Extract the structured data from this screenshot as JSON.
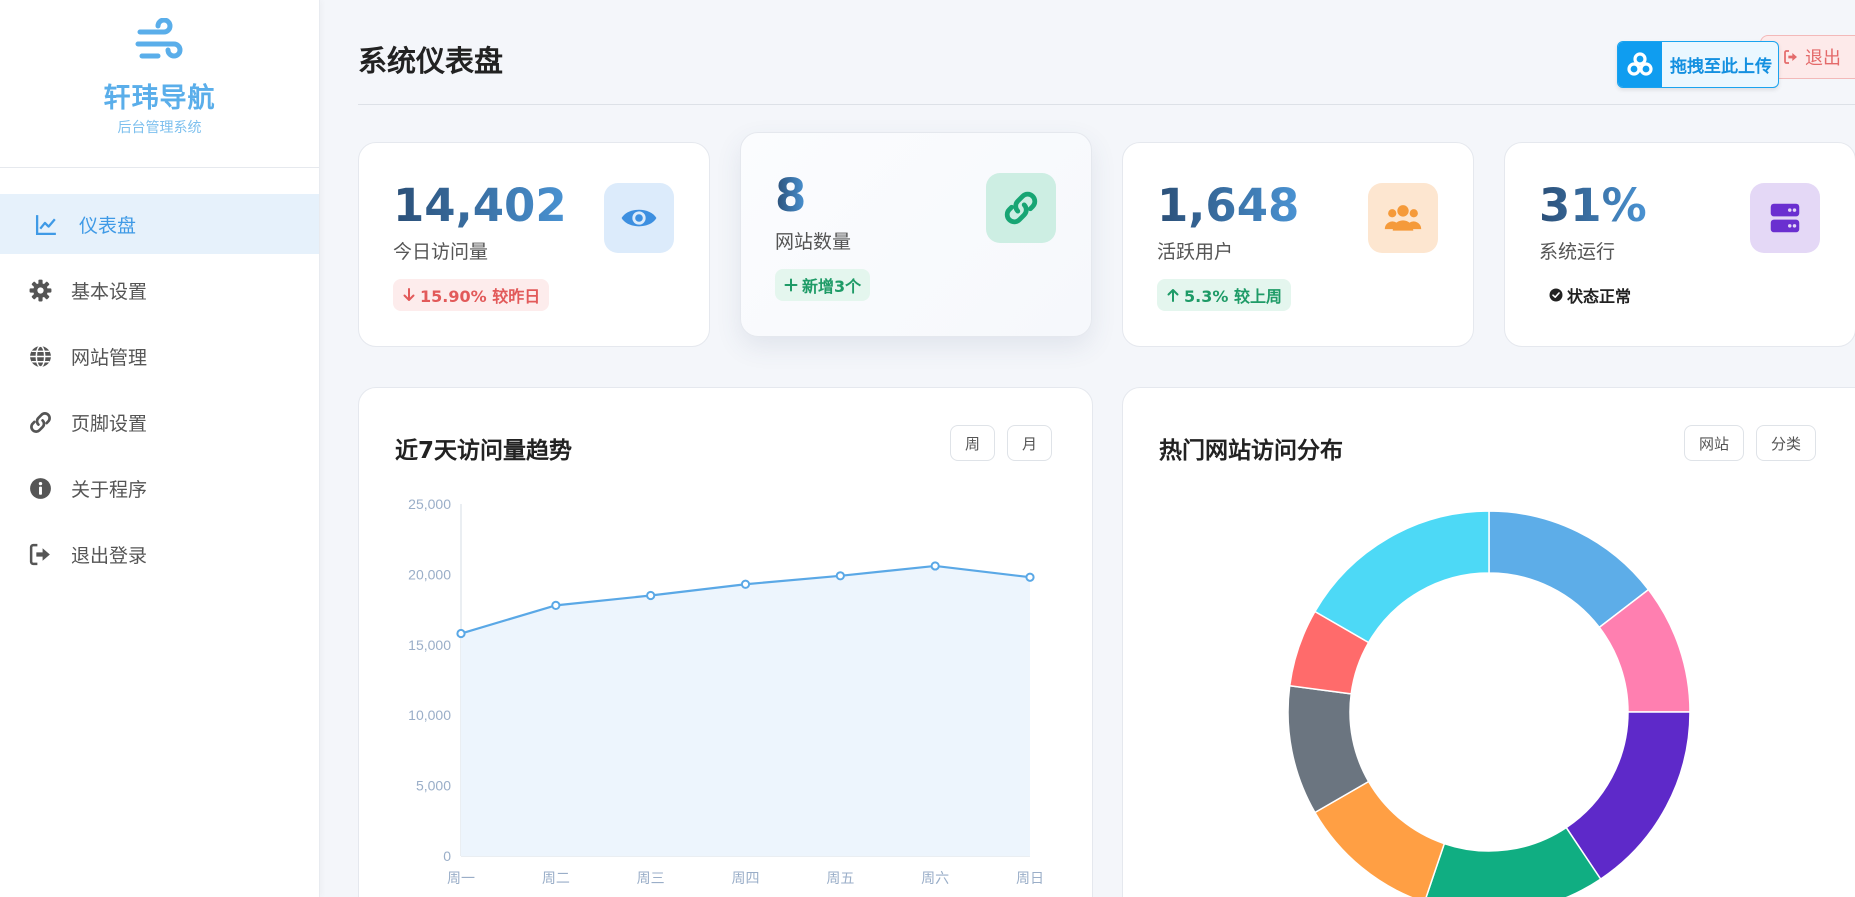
{
  "brand": {
    "name": "轩玮导航",
    "subtitle": "后台管理系统"
  },
  "sidebar": {
    "items": [
      {
        "label": "仪表盘",
        "icon": "chart-line-icon",
        "active": true
      },
      {
        "label": "基本设置",
        "icon": "gear-icon"
      },
      {
        "label": "网站管理",
        "icon": "globe-icon"
      },
      {
        "label": "页脚设置",
        "icon": "link-icon"
      },
      {
        "label": "关于程序",
        "icon": "info-icon"
      },
      {
        "label": "退出登录",
        "icon": "sign-out-icon"
      }
    ]
  },
  "header": {
    "title": "系统仪表盘",
    "logout_label": "退出",
    "upload_label": "拖拽至此上传"
  },
  "stats": [
    {
      "value": "14,402",
      "label": "今日访问量",
      "badge": "15.90% 较昨日",
      "trend": "down",
      "icon": "eye-icon",
      "icon_bg": "#dcebfb",
      "icon_color": "#3d8fe0"
    },
    {
      "value": "8",
      "label": "网站数量",
      "badge": "新增3个",
      "trend": "plus",
      "icon": "link-icon",
      "icon_bg": "#cdeee3",
      "icon_color": "#18a574"
    },
    {
      "value": "1,648",
      "label": "活跃用户",
      "badge": "5.3% 较上周",
      "trend": "up",
      "icon": "users-icon",
      "icon_bg": "#fde6d0",
      "icon_color": "#f59a3a"
    },
    {
      "value": "31%",
      "label": "系统运行",
      "badge": "状态正常",
      "trend": "ok",
      "icon": "server-icon",
      "icon_bg": "#e4d8f6",
      "icon_color": "#6a2fd0"
    }
  ],
  "trend_panel": {
    "title": "近7天访问量趋势",
    "btn_week": "周",
    "btn_month": "月"
  },
  "pie_panel": {
    "title": "热门网站访问分布",
    "btn_site": "网站",
    "btn_category": "分类"
  },
  "chart_data": [
    {
      "type": "line",
      "categories": [
        "周一",
        "周二",
        "周三",
        "周四",
        "周五",
        "周六",
        "周日"
      ],
      "values": [
        15800,
        17800,
        18500,
        19300,
        19900,
        20600,
        19800
      ],
      "ylim": [
        0,
        25000
      ],
      "yticks": [
        "0",
        "5,000",
        "10,000",
        "15,000",
        "20,000",
        "25,000"
      ],
      "color": "#5aa8e6",
      "fill": "#edf5fd"
    },
    {
      "type": "pie",
      "donut": true,
      "values": [
        14,
        10,
        15,
        14,
        11,
        10,
        6,
        16
      ],
      "colors": [
        "#5dade8",
        "#ff7fb0",
        "#5e29c9",
        "#10ae82",
        "#ff9f44",
        "#6b7580",
        "#ff6b6b",
        "#4dd9f6"
      ]
    }
  ]
}
